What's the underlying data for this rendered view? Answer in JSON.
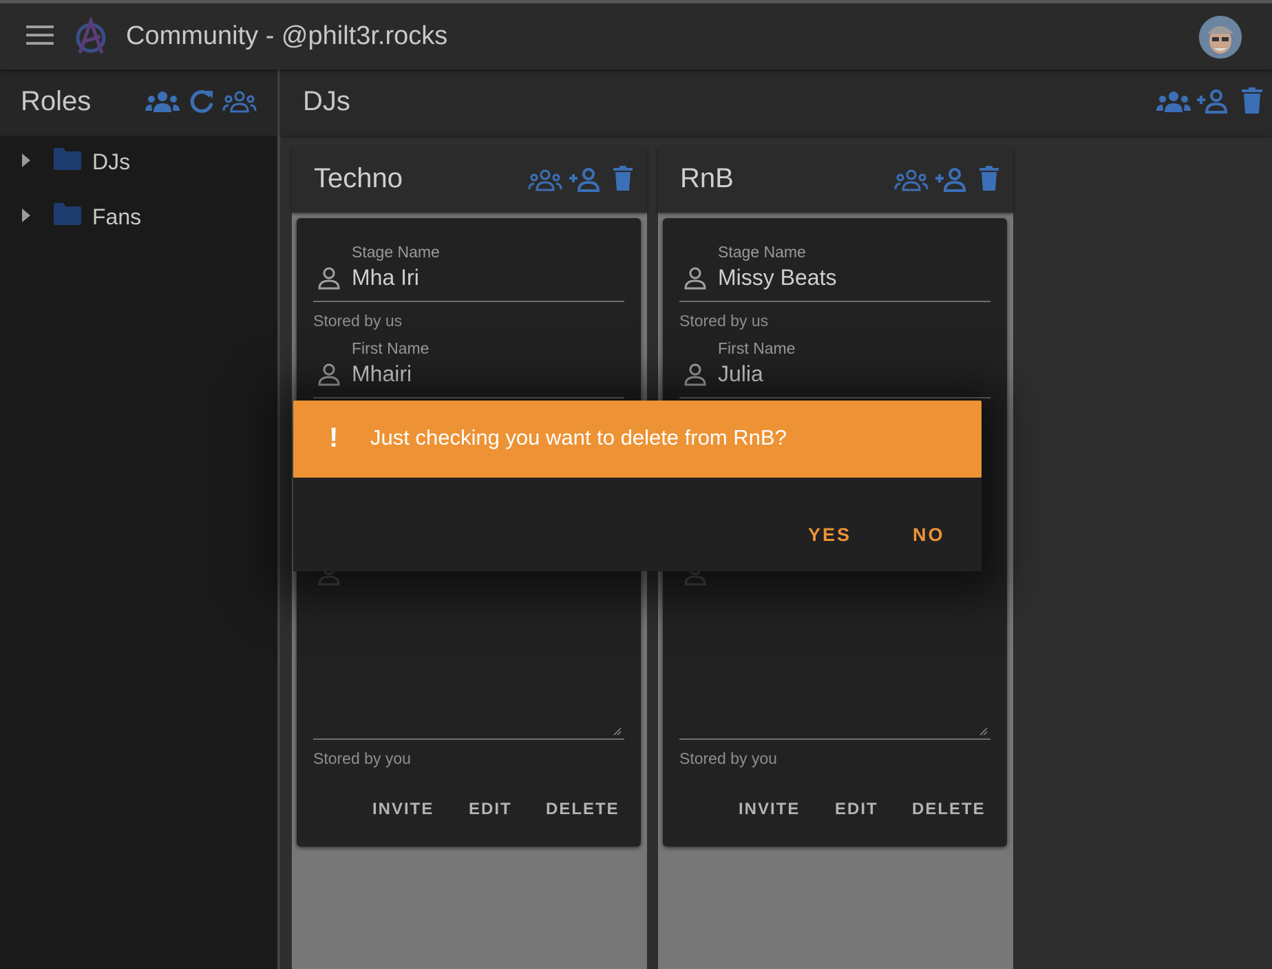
{
  "app": {
    "title": "Community - @philt3r.rocks"
  },
  "sidebar": {
    "title": "Roles",
    "items": [
      {
        "label": "DJs"
      },
      {
        "label": "Fans"
      }
    ]
  },
  "main": {
    "title": "DJs",
    "columns": [
      {
        "title": "Techno",
        "card": {
          "stage_name_label": "Stage Name",
          "stage_name_value": "Mha Iri",
          "stored_by_us": "Stored by us",
          "first_name_label": "First Name",
          "first_name_value": "Mhairi",
          "stored_by_you": "Stored by you",
          "invite": "INVITE",
          "edit": "EDIT",
          "delete": "DELETE"
        }
      },
      {
        "title": "RnB",
        "card": {
          "stage_name_label": "Stage Name",
          "stage_name_value": "Missy Beats",
          "stored_by_us": "Stored by us",
          "first_name_label": "First Name",
          "first_name_value": "Julia",
          "stored_by_you": "Stored by you",
          "invite": "INVITE",
          "edit": "EDIT",
          "delete": "DELETE"
        }
      }
    ]
  },
  "dialog": {
    "icon": "!",
    "message": "Just checking you want to delete from RnB?",
    "yes": "YES",
    "no": "NO"
  },
  "colors": {
    "accent_blue": "#3b6fb6",
    "warning_orange": "#ed9335"
  }
}
